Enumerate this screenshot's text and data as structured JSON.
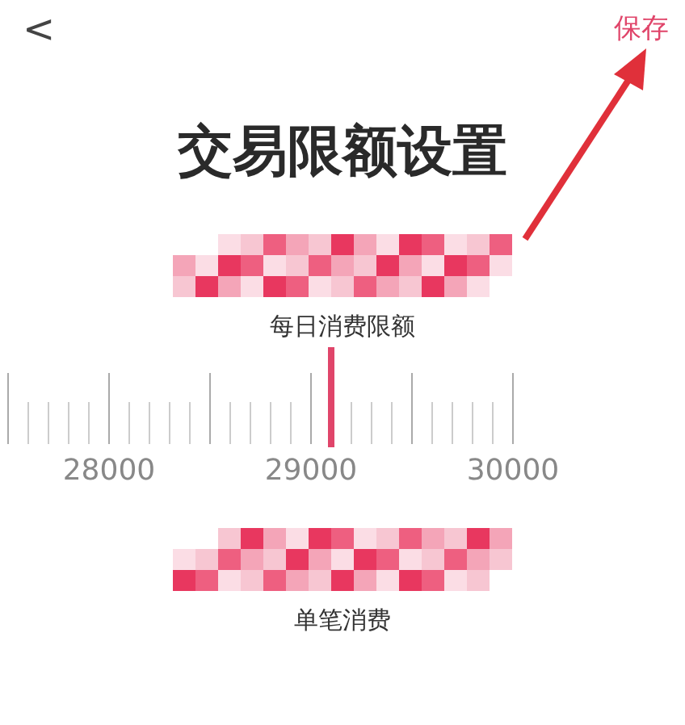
{
  "header": {
    "back": "<",
    "action": "保存"
  },
  "title": "交易限额设置",
  "limits": [
    {
      "label": "每日消费限额",
      "value_redacted": true,
      "ruler": {
        "labels": [
          "28000",
          "29000",
          "30000"
        ]
      }
    },
    {
      "label": "单笔消费",
      "value_redacted": true
    }
  ],
  "annotation": {
    "kind": "arrow"
  }
}
